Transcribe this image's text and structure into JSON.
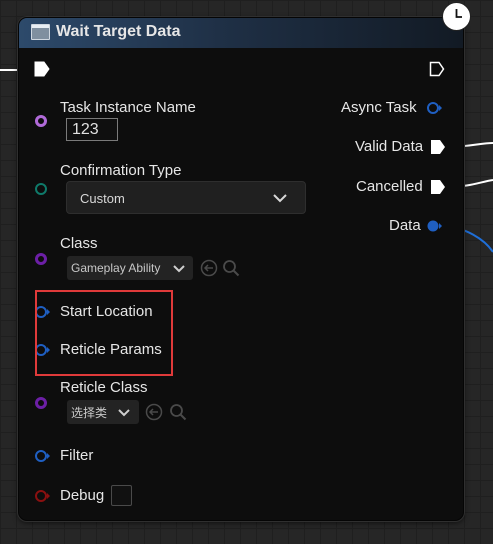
{
  "node": {
    "title": "Wait Target Data"
  },
  "inputs": {
    "task_instance_name": {
      "label": "Task Instance Name",
      "value": "123"
    },
    "confirmation_type": {
      "label": "Confirmation Type",
      "value": "Custom"
    },
    "class": {
      "label": "Class",
      "value": "Gameplay Ability"
    },
    "start_location": {
      "label": "Start Location"
    },
    "reticle_params": {
      "label": "Reticle Params"
    },
    "reticle_class": {
      "label": "Reticle Class",
      "value": "选择类"
    },
    "filter": {
      "label": "Filter"
    },
    "debug": {
      "label": "Debug"
    }
  },
  "outputs": {
    "async_task": {
      "label": "Async Task"
    },
    "valid_data": {
      "label": "Valid Data"
    },
    "cancelled": {
      "label": "Cancelled"
    },
    "data": {
      "label": "Data"
    }
  },
  "colors": {
    "object_pin": "#b06ad8",
    "byte_pin": "#0f7a6a",
    "class_pin": "#6c1fa6",
    "struct_pin": "#1f5fc2",
    "bool_pin": "#8a1010",
    "exec_pin": "#ffffff",
    "highlight": "#e03a3a"
  },
  "icons": {
    "header": "function-node-icon",
    "latent": "clock-icon",
    "use_selected": "arrow-left-circle-icon",
    "browse": "magnifier-icon",
    "dropdown": "chevron-down-icon"
  }
}
